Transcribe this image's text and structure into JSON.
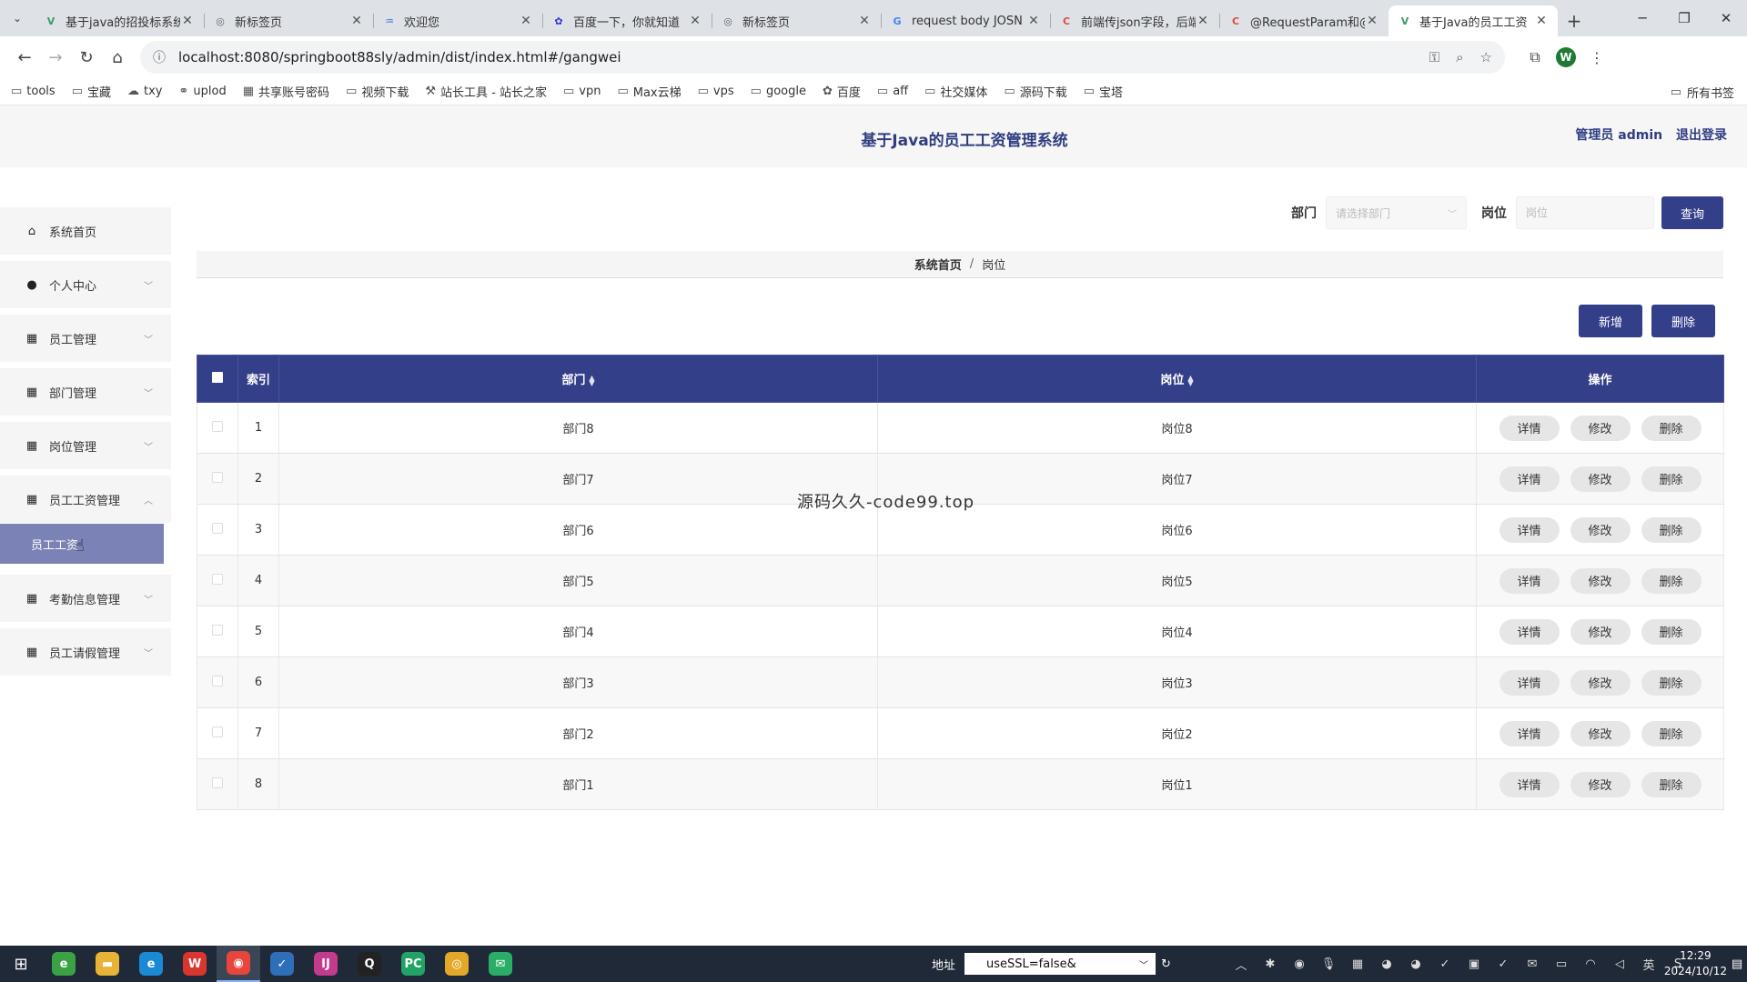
{
  "browser": {
    "tabs": [
      {
        "title": "基于java的招投标系统",
        "favicon": "V",
        "color": "#3c9b69"
      },
      {
        "title": "新标签页",
        "favicon": "◎",
        "color": "#5f6368"
      },
      {
        "title": "欢迎您",
        "favicon": "♒",
        "color": "#3a78c4"
      },
      {
        "title": "百度一下，你就知道",
        "favicon": "✿",
        "color": "#2932e1"
      },
      {
        "title": "新标签页",
        "favicon": "◎",
        "color": "#5f6368"
      },
      {
        "title": "request body JOSN",
        "favicon": "G",
        "color": "#4285f4"
      },
      {
        "title": "前端传json字段，后端",
        "favicon": "C",
        "color": "#e2493a"
      },
      {
        "title": "@RequestParam和@",
        "favicon": "C",
        "color": "#e2493a"
      },
      {
        "title": "基于Java的员工工资",
        "favicon": "V",
        "color": "#3c9b69",
        "active": true
      }
    ],
    "url": "localhost:8080/springboot88sly/admin/dist/index.html#/gangwei",
    "profile_initial": "W",
    "bookmarks": [
      {
        "label": "tools",
        "icon": "folder-icon"
      },
      {
        "label": "宝藏",
        "icon": "folder-icon"
      },
      {
        "label": "txy",
        "icon": "cloud-icon"
      },
      {
        "label": "uplod",
        "icon": "link-icon"
      },
      {
        "label": "共享账号密码",
        "icon": "grid-icon"
      },
      {
        "label": "视频下载",
        "icon": "folder-icon"
      },
      {
        "label": "站长工具 - 站长之家",
        "icon": "tool-icon"
      },
      {
        "label": "vpn",
        "icon": "folder-icon"
      },
      {
        "label": "Max云梯",
        "icon": "folder-icon"
      },
      {
        "label": "vps",
        "icon": "folder-icon"
      },
      {
        "label": "google",
        "icon": "folder-icon"
      },
      {
        "label": "百度",
        "icon": "paw-icon"
      },
      {
        "label": "aff",
        "icon": "folder-icon"
      },
      {
        "label": "社交媒体",
        "icon": "folder-icon"
      },
      {
        "label": "源码下载",
        "icon": "folder-icon"
      },
      {
        "label": "宝塔",
        "icon": "folder-icon"
      }
    ],
    "all_bookmarks": "所有书签"
  },
  "app": {
    "title": "基于Java的员工工资管理系统",
    "user_label": "管理员 admin",
    "logout": "退出登录"
  },
  "sidebar": {
    "items": [
      {
        "label": "系统首页",
        "icon": "home-icon",
        "chevron": ""
      },
      {
        "label": "个人中心",
        "icon": "user-icon",
        "chevron": "﹀"
      },
      {
        "label": "员工管理",
        "icon": "grid-icon",
        "chevron": "﹀"
      },
      {
        "label": "部门管理",
        "icon": "grid-icon",
        "chevron": "﹀"
      },
      {
        "label": "岗位管理",
        "icon": "grid-icon",
        "chevron": "﹀"
      },
      {
        "label": "员工工资管理",
        "icon": "grid-icon",
        "chevron": "︿"
      },
      {
        "label": "考勤信息管理",
        "icon": "grid-icon",
        "chevron": "﹀"
      },
      {
        "label": "员工请假管理",
        "icon": "grid-icon",
        "chevron": "﹀"
      }
    ],
    "submenu_active": "员工工资"
  },
  "filter": {
    "dept_label": "部门",
    "dept_placeholder": "请选择部门",
    "post_label": "岗位",
    "post_placeholder": "岗位",
    "query_button": "查询"
  },
  "breadcrumb": {
    "home": "系统首页",
    "sep": "/",
    "current": "岗位"
  },
  "actions": {
    "add": "新增",
    "delete": "删除"
  },
  "table": {
    "headers": {
      "index": "索引",
      "dept": "部门",
      "post": "岗位",
      "ops": "操作"
    },
    "op_labels": {
      "detail": "详情",
      "edit": "修改",
      "delete": "删除"
    },
    "rows": [
      {
        "index": "1",
        "dept": "部门8",
        "post": "岗位8"
      },
      {
        "index": "2",
        "dept": "部门7",
        "post": "岗位7"
      },
      {
        "index": "3",
        "dept": "部门6",
        "post": "岗位6"
      },
      {
        "index": "4",
        "dept": "部门5",
        "post": "岗位5"
      },
      {
        "index": "5",
        "dept": "部门4",
        "post": "岗位4"
      },
      {
        "index": "6",
        "dept": "部门3",
        "post": "岗位3"
      },
      {
        "index": "7",
        "dept": "部门2",
        "post": "岗位2"
      },
      {
        "index": "8",
        "dept": "部门1",
        "post": "岗位1"
      }
    ]
  },
  "watermark": "源码久久-code99.top",
  "taskbar": {
    "apps": [
      {
        "name": "browser-360-icon",
        "glyph": "e",
        "color": "#3aa245"
      },
      {
        "name": "file-explorer-icon",
        "glyph": "▬",
        "color": "#e8b437"
      },
      {
        "name": "edge-icon",
        "glyph": "e",
        "color": "#1b8ad6"
      },
      {
        "name": "wps-icon",
        "glyph": "W",
        "color": "#d9362f"
      },
      {
        "name": "chrome-icon",
        "glyph": "◉",
        "color": "#e8453c",
        "active": true
      },
      {
        "name": "vscode-icon",
        "glyph": "✓",
        "color": "#2d6fb8"
      },
      {
        "name": "intellij-icon",
        "glyph": "IJ",
        "color": "#c43a8c"
      },
      {
        "name": "qq-icon",
        "glyph": "Q",
        "color": "#222"
      },
      {
        "name": "pycharm-icon",
        "glyph": "PC",
        "color": "#21a366"
      },
      {
        "name": "browser-icon",
        "glyph": "◎",
        "color": "#e3a72a"
      },
      {
        "name": "wechat-icon",
        "glyph": "✉",
        "color": "#2aae67"
      }
    ],
    "address_label": "地址",
    "address_value": "useSSL=false&",
    "time": "12:29",
    "date": "2024/10/12",
    "ime": "英"
  }
}
